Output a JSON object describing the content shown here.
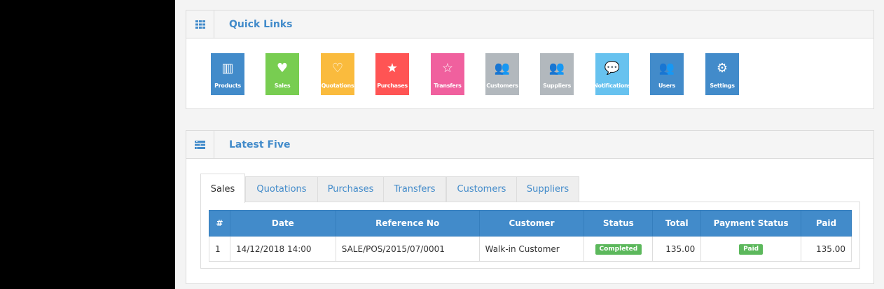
{
  "quick_links": {
    "title": "Quick Links",
    "items": [
      {
        "label": "Products",
        "icon": "barcode-icon",
        "glyph": "▥",
        "color": "#428bca"
      },
      {
        "label": "Sales",
        "icon": "heart-icon",
        "glyph": "♥",
        "color": "#78cd51"
      },
      {
        "label": "Quotations",
        "icon": "heart-outline-icon",
        "glyph": "♡",
        "color": "#fabb3d"
      },
      {
        "label": "Purchases",
        "icon": "star-icon",
        "glyph": "★",
        "color": "#ff5454"
      },
      {
        "label": "Transfers",
        "icon": "star-outline-icon",
        "glyph": "☆",
        "color": "#f0609e"
      },
      {
        "label": "Customers",
        "icon": "users-icon",
        "glyph": "👥",
        "color": "#b2b8bd"
      },
      {
        "label": "Suppliers",
        "icon": "users-icon",
        "glyph": "👥",
        "color": "#b2b8bd"
      },
      {
        "label": "Notifications",
        "icon": "comments-icon",
        "glyph": "💬",
        "color": "#67c2ef"
      },
      {
        "label": "Users",
        "icon": "users-icon",
        "glyph": "👥",
        "color": "#428bca"
      },
      {
        "label": "Settings",
        "icon": "cogs-icon",
        "glyph": "⚙",
        "color": "#428bca"
      }
    ]
  },
  "latest": {
    "title": "Latest Five",
    "tabs": [
      "Sales",
      "Quotations",
      "Purchases",
      "Transfers",
      "Customers",
      "Suppliers"
    ],
    "active_tab": "Sales",
    "columns": [
      "#",
      "Date",
      "Reference No",
      "Customer",
      "Status",
      "Total",
      "Payment Status",
      "Paid"
    ],
    "rows": [
      {
        "num": "1",
        "date": "14/12/2018 14:00",
        "reference": "SALE/POS/2015/07/0001",
        "customer": "Walk-in Customer",
        "status": "Completed",
        "total": "135.00",
        "payment_status": "Paid",
        "paid": "135.00"
      }
    ]
  }
}
